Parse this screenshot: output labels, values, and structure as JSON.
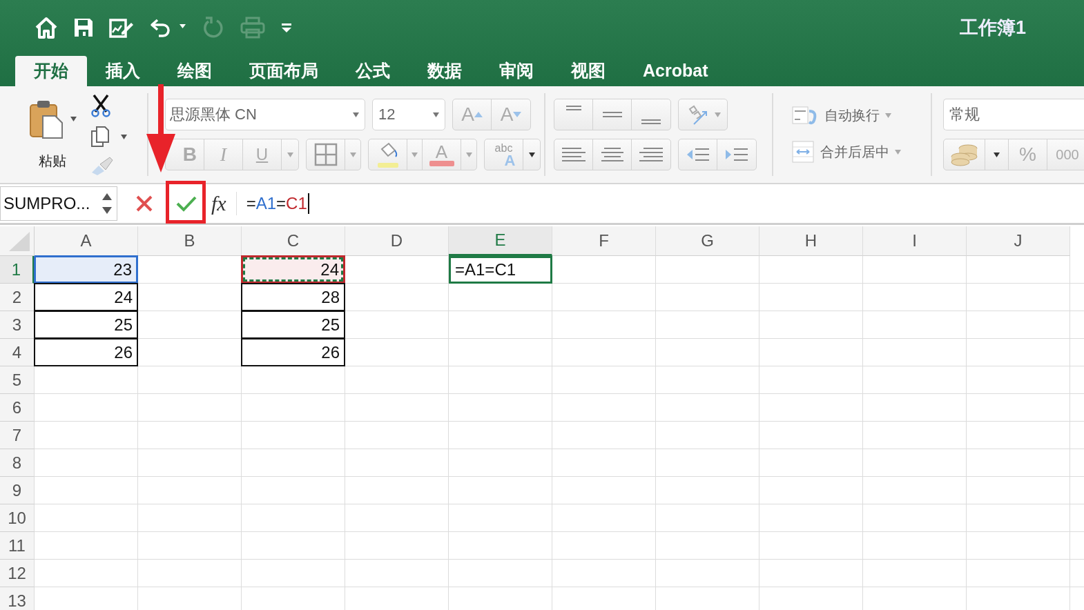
{
  "title_bar": {
    "quick_access": [
      {
        "kind": "home",
        "disabled": false
      },
      {
        "kind": "save",
        "disabled": false
      },
      {
        "kind": "edit",
        "disabled": false
      },
      {
        "kind": "undo",
        "disabled": false
      },
      {
        "kind": "redo",
        "disabled": true
      },
      {
        "kind": "print",
        "disabled": true
      },
      {
        "kind": "customize",
        "disabled": false
      }
    ],
    "title": "工作簿1"
  },
  "tabs": [
    {
      "label": "开始",
      "selected": true
    },
    {
      "label": "插入",
      "selected": false
    },
    {
      "label": "绘图",
      "selected": false
    },
    {
      "label": "页面布局",
      "selected": false
    },
    {
      "label": "公式",
      "selected": false
    },
    {
      "label": "数据",
      "selected": false
    },
    {
      "label": "审阅",
      "selected": false
    },
    {
      "label": "视图",
      "selected": false
    },
    {
      "label": "Acrobat",
      "selected": false
    }
  ],
  "ribbon": {
    "paste_label": "粘贴",
    "font_name": "思源黑体 CN",
    "font_size": "12",
    "grow_font": "A",
    "shrink_font": "A",
    "bold": "B",
    "italic": "I",
    "underline": "U",
    "font_color": "A",
    "text_effects": "abc",
    "text_effects_letter": "A",
    "wrap_text": "自动换行",
    "merge_center": "合并后居中",
    "number_format": "常规",
    "percent": "%",
    "thousands": "000"
  },
  "formula_bar": {
    "name_box": "SUMPRO...",
    "function_label": "fx",
    "formula": [
      {
        "text": "=",
        "color": "#222222"
      },
      {
        "text": "A1",
        "color": "#2f6fce"
      },
      {
        "text": "=",
        "color": "#222222"
      },
      {
        "text": "C1",
        "color": "#c0282d"
      }
    ]
  },
  "sheet": {
    "columns": [
      {
        "label": "A",
        "selected": false
      },
      {
        "label": "B",
        "selected": false
      },
      {
        "label": "C",
        "selected": false
      },
      {
        "label": "D",
        "selected": false
      },
      {
        "label": "E",
        "selected": true
      },
      {
        "label": "F",
        "selected": false
      },
      {
        "label": "G",
        "selected": false
      },
      {
        "label": "H",
        "selected": false
      },
      {
        "label": "I",
        "selected": false
      },
      {
        "label": "J",
        "selected": false
      }
    ],
    "rows": [
      {
        "label": "1",
        "selected": true,
        "cells": [
          {
            "text": "23",
            "kind": "reference",
            "color": "#2f6fce",
            "bordered": true
          },
          {},
          {
            "text": "24",
            "kind": "copied_reference",
            "color": "#c0282d",
            "bordered": true
          },
          {},
          {
            "text": "=A1=C1",
            "kind": "active"
          },
          {},
          {},
          {},
          {},
          {}
        ]
      },
      {
        "label": "2",
        "selected": false,
        "cells": [
          {
            "text": "24",
            "kind": "plain",
            "bordered": true
          },
          {},
          {
            "text": "28",
            "kind": "plain",
            "bordered": true
          },
          {},
          {},
          {},
          {},
          {},
          {},
          {}
        ]
      },
      {
        "label": "3",
        "selected": false,
        "cells": [
          {
            "text": "25",
            "kind": "plain",
            "bordered": true
          },
          {},
          {
            "text": "25",
            "kind": "plain",
            "bordered": true
          },
          {},
          {},
          {},
          {},
          {},
          {},
          {}
        ]
      },
      {
        "label": "4",
        "selected": false,
        "cells": [
          {
            "text": "26",
            "kind": "plain",
            "bordered": true
          },
          {},
          {
            "text": "26",
            "kind": "plain",
            "bordered": true
          },
          {},
          {},
          {},
          {},
          {},
          {},
          {}
        ]
      },
      {
        "label": "5",
        "selected": false,
        "cells": [
          {},
          {},
          {},
          {},
          {},
          {},
          {},
          {},
          {},
          {}
        ]
      },
      {
        "label": "6",
        "selected": false,
        "cells": [
          {},
          {},
          {},
          {},
          {},
          {},
          {},
          {},
          {},
          {}
        ]
      },
      {
        "label": "7",
        "selected": false,
        "cells": [
          {},
          {},
          {},
          {},
          {},
          {},
          {},
          {},
          {},
          {}
        ]
      },
      {
        "label": "8",
        "selected": false,
        "cells": [
          {},
          {},
          {},
          {},
          {},
          {},
          {},
          {},
          {},
          {}
        ]
      },
      {
        "label": "9",
        "selected": false,
        "cells": [
          {},
          {},
          {},
          {},
          {},
          {},
          {},
          {},
          {},
          {}
        ]
      },
      {
        "label": "10",
        "selected": false,
        "cells": [
          {},
          {},
          {},
          {},
          {},
          {},
          {},
          {},
          {},
          {}
        ]
      },
      {
        "label": "11",
        "selected": false,
        "cells": [
          {},
          {},
          {},
          {},
          {},
          {},
          {},
          {},
          {},
          {}
        ]
      },
      {
        "label": "12",
        "selected": false,
        "cells": [
          {},
          {},
          {},
          {},
          {},
          {},
          {},
          {},
          {},
          {}
        ]
      },
      {
        "label": "13",
        "selected": false,
        "cells": [
          {},
          {},
          {},
          {},
          {},
          {},
          {},
          {},
          {},
          {}
        ]
      }
    ]
  }
}
